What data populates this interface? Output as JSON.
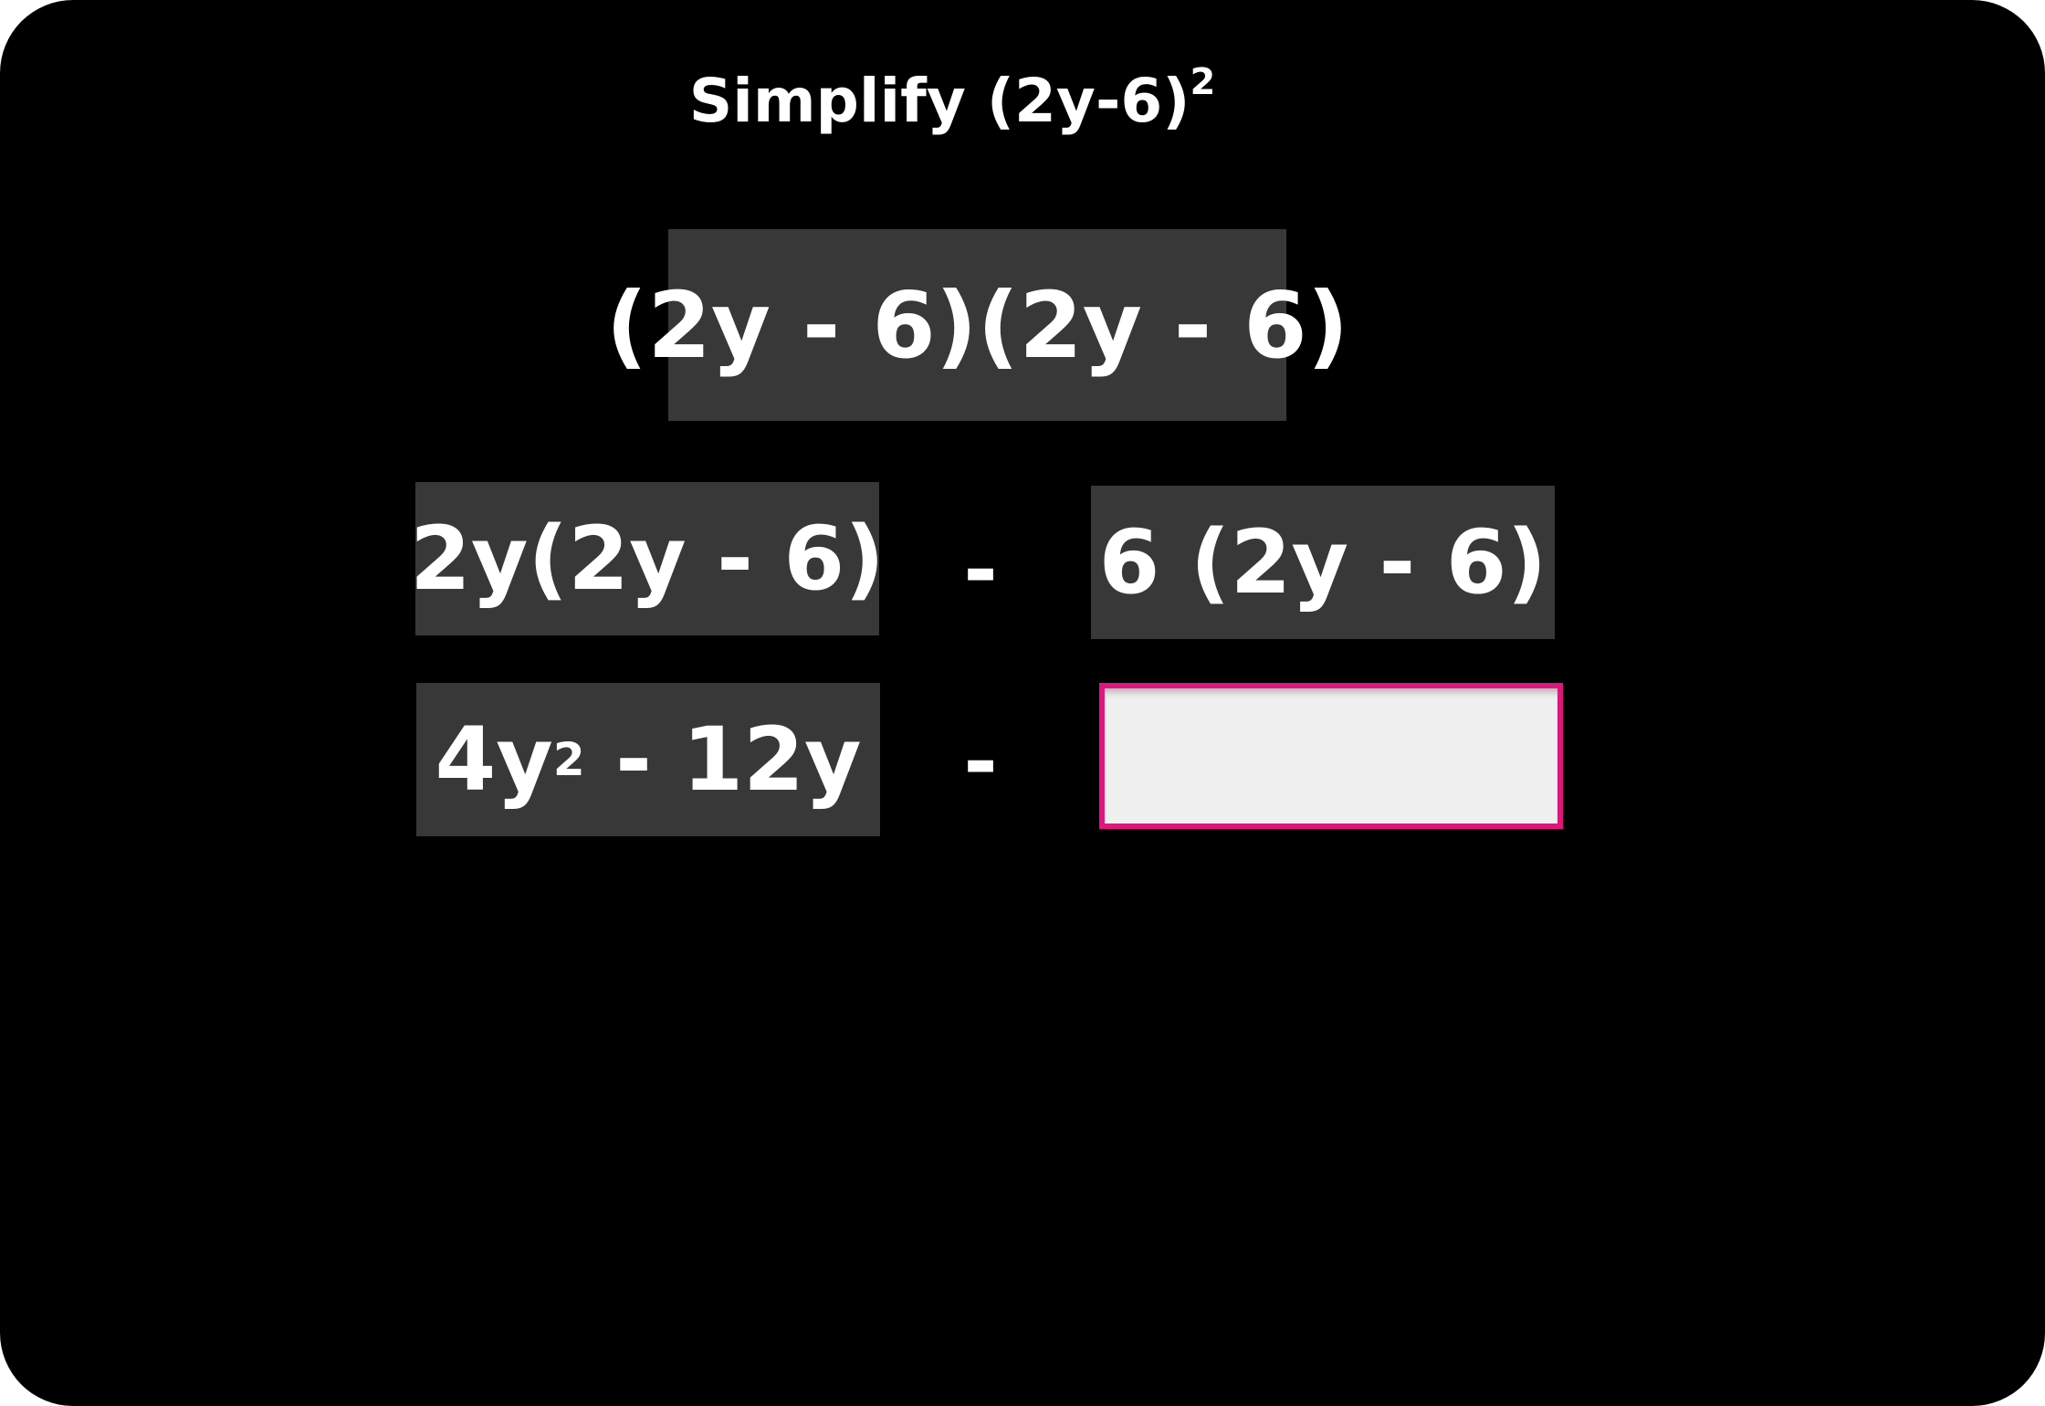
{
  "title": {
    "prefix": "Simplify (2y-6)",
    "exponent": "2"
  },
  "expansion": "(2y - 6)(2y - 6)",
  "distribution": {
    "left": "2y(2y - 6)",
    "operator": "-",
    "right": "6 (2y - 6)"
  },
  "result_row": {
    "left_base": "4y",
    "left_exponent": "2",
    "left_rest": " - 12y",
    "operator": "-",
    "answer_value": ""
  },
  "colors": {
    "background": "#000000",
    "tile": "#383838",
    "answer_border": "#e0157e",
    "answer_fill": "#f0f0f0"
  }
}
